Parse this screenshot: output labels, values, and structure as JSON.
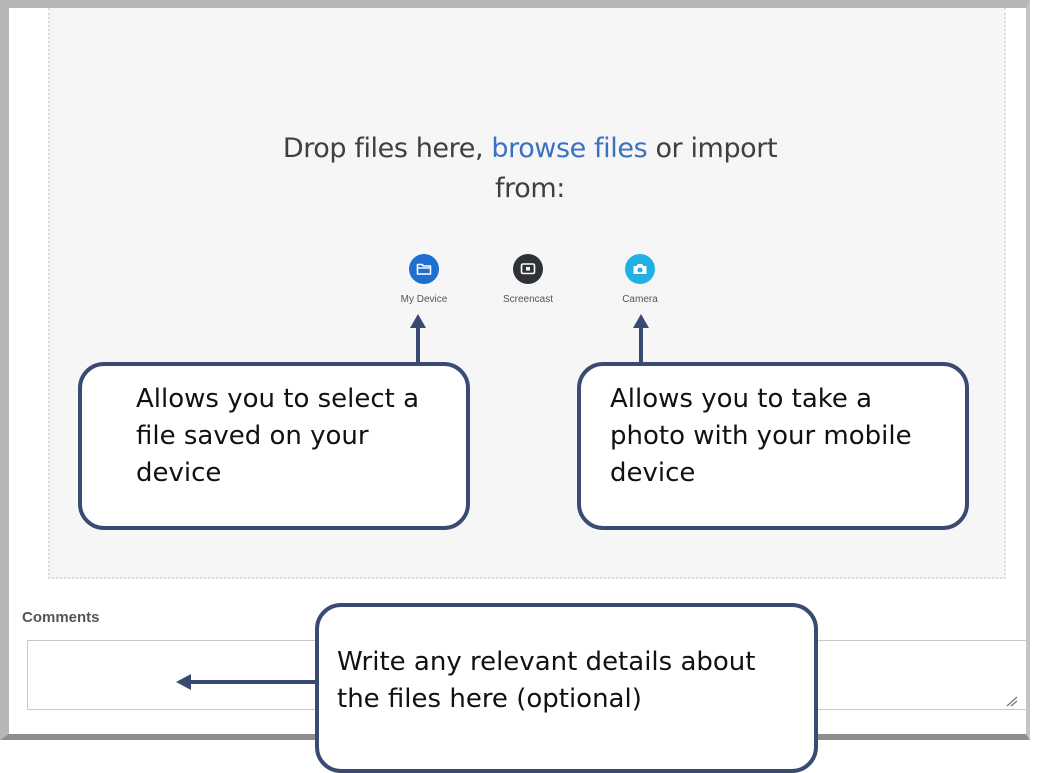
{
  "dropzone": {
    "prefix": "Drop files here,",
    "browse_link": "browse files",
    "suffix": "or import",
    "suffix2": "from:"
  },
  "sources": [
    {
      "label": "My Device",
      "icon": "folder-icon",
      "color": "#1f6fd0"
    },
    {
      "label": "Screencast",
      "icon": "screencast-icon",
      "color": "#2e3237"
    },
    {
      "label": "Camera",
      "icon": "camera-icon",
      "color": "#22b0e4"
    }
  ],
  "callouts": {
    "device": "Allows you to select a file saved on your device",
    "camera": "Allows you to take a photo with your mobile device",
    "comments": "Write any relevant details about the files here (optional)"
  },
  "comments": {
    "label": "Comments",
    "value": ""
  },
  "colors": {
    "accent_link": "#3a72c0",
    "callout_border": "#3a4a72"
  }
}
